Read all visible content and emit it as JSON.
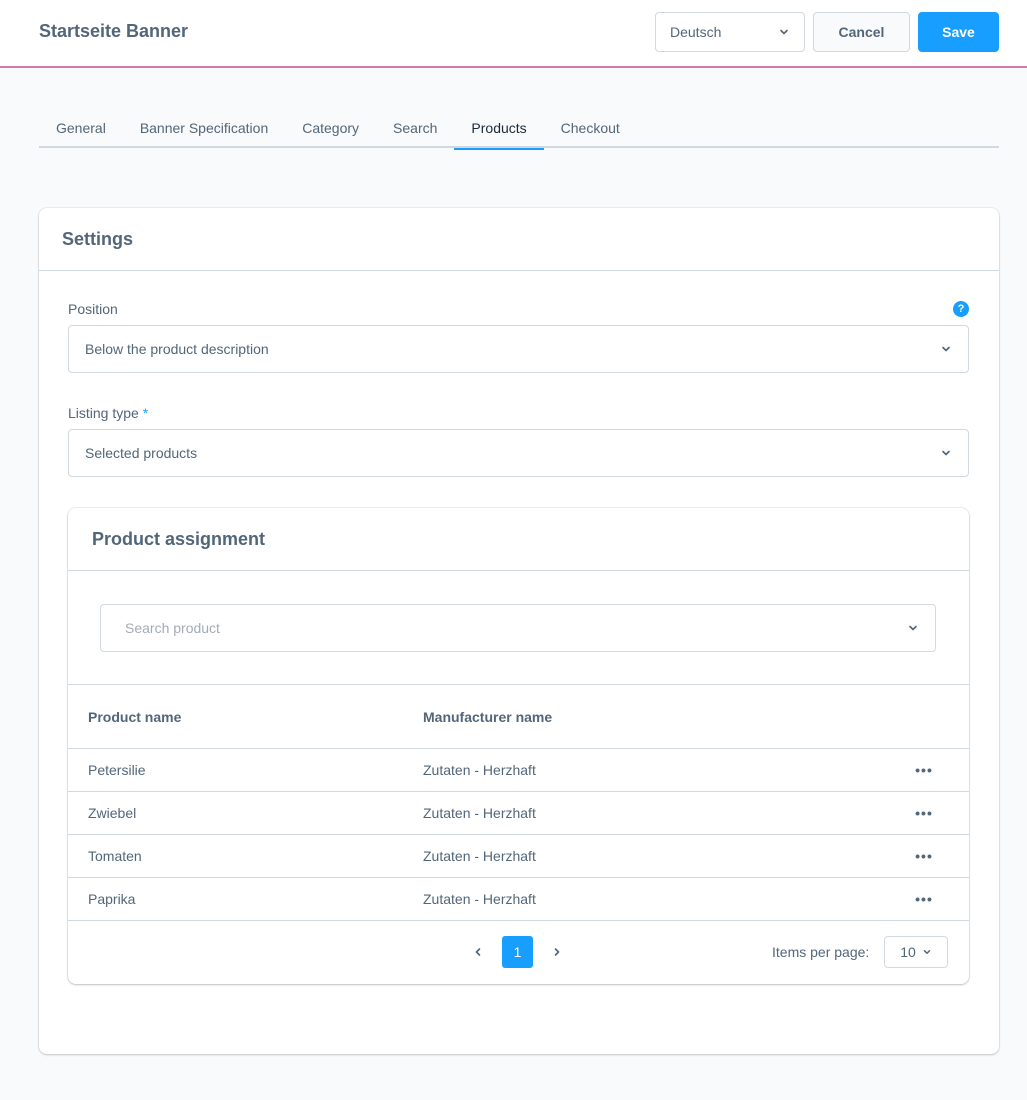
{
  "header": {
    "title": "Startseite Banner",
    "language": "Deutsch",
    "cancel_label": "Cancel",
    "save_label": "Save"
  },
  "tabs": [
    {
      "label": "General",
      "active": false
    },
    {
      "label": "Banner Specification",
      "active": false
    },
    {
      "label": "Category",
      "active": false
    },
    {
      "label": "Search",
      "active": false
    },
    {
      "label": "Products",
      "active": true
    },
    {
      "label": "Checkout",
      "active": false
    }
  ],
  "settings": {
    "title": "Settings",
    "position": {
      "label": "Position",
      "value": "Below the product description",
      "help_icon": "question-circle-icon"
    },
    "listing_type": {
      "label": "Listing type",
      "required_marker": "*",
      "value": "Selected products"
    }
  },
  "product_assignment": {
    "title": "Product assignment",
    "search_placeholder": "Search product",
    "columns": [
      "Product name",
      "Manufacturer name"
    ],
    "rows": [
      {
        "name": "Petersilie",
        "manufacturer": "Zutaten - Herzhaft"
      },
      {
        "name": "Zwiebel",
        "manufacturer": "Zutaten - Herzhaft"
      },
      {
        "name": "Tomaten",
        "manufacturer": "Zutaten - Herzhaft"
      },
      {
        "name": "Paprika",
        "manufacturer": "Zutaten - Herzhaft"
      }
    ],
    "row_action_glyph": "•••",
    "pagination": {
      "current_page": "1",
      "items_per_page_label": "Items per page:",
      "items_per_page": "10"
    }
  },
  "colors": {
    "accent": "#189eff",
    "header_border": "#d07ab0",
    "text": "#52667a",
    "border": "#d1d9e0",
    "background": "#f9fafb"
  }
}
